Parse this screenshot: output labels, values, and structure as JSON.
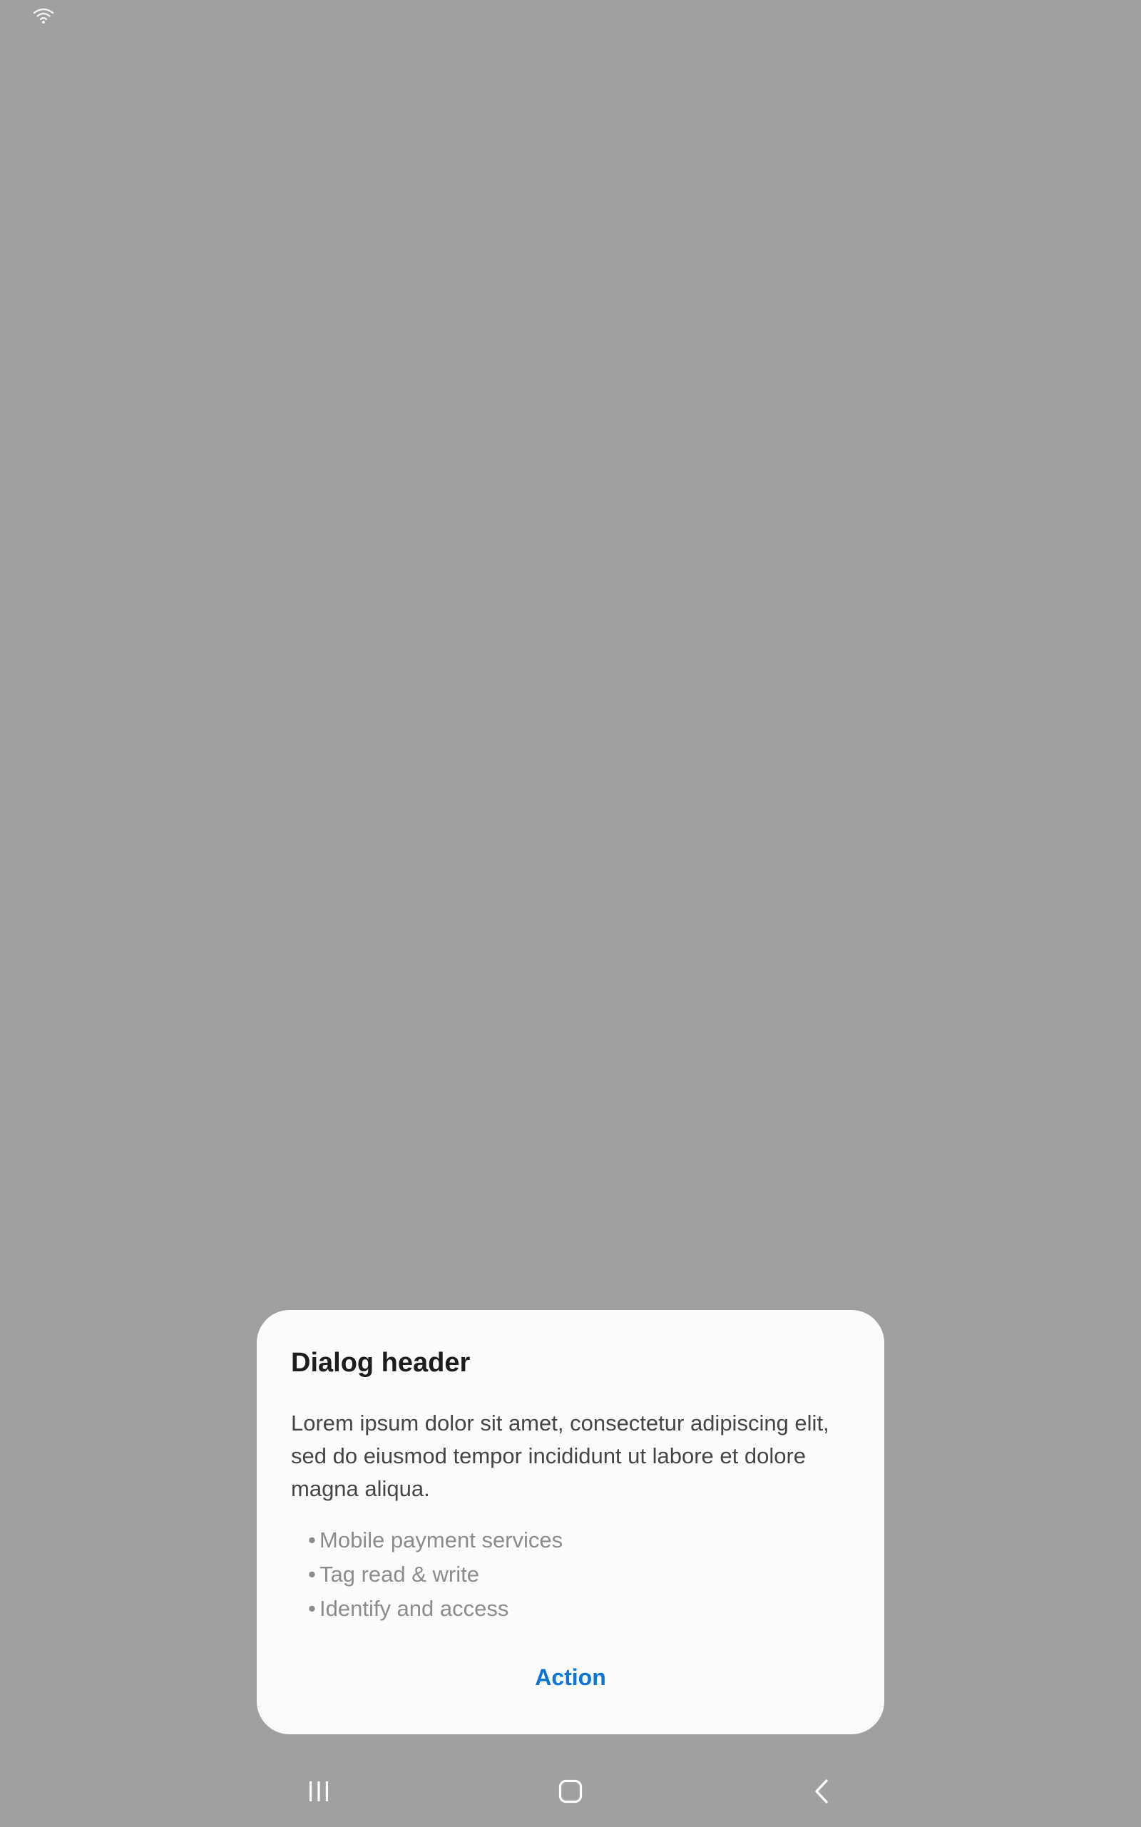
{
  "status_bar": {
    "icons": [
      "wifi-icon"
    ]
  },
  "dialog": {
    "title": "Dialog header",
    "body": "Lorem ipsum dolor sit amet, consectetur adipiscing elit, sed do eiusmod tempor incididunt ut labore et dolore magna aliqua.",
    "bullet_symbol": "•",
    "items": [
      "Mobile payment services",
      "Tag read & write",
      "Identify and access"
    ],
    "action_label": "Action"
  },
  "navigation_bar": {
    "buttons": [
      "recents-icon",
      "home-icon",
      "back-icon"
    ]
  },
  "colors": {
    "background_scrim": "#a0a0a0",
    "dialog_background": "#fcfcfc",
    "title": "#1d1d1d",
    "body_text": "#454545",
    "list_text": "#8c8c8c",
    "accent": "#0c74d6",
    "nav_icons": "#ffffff"
  }
}
